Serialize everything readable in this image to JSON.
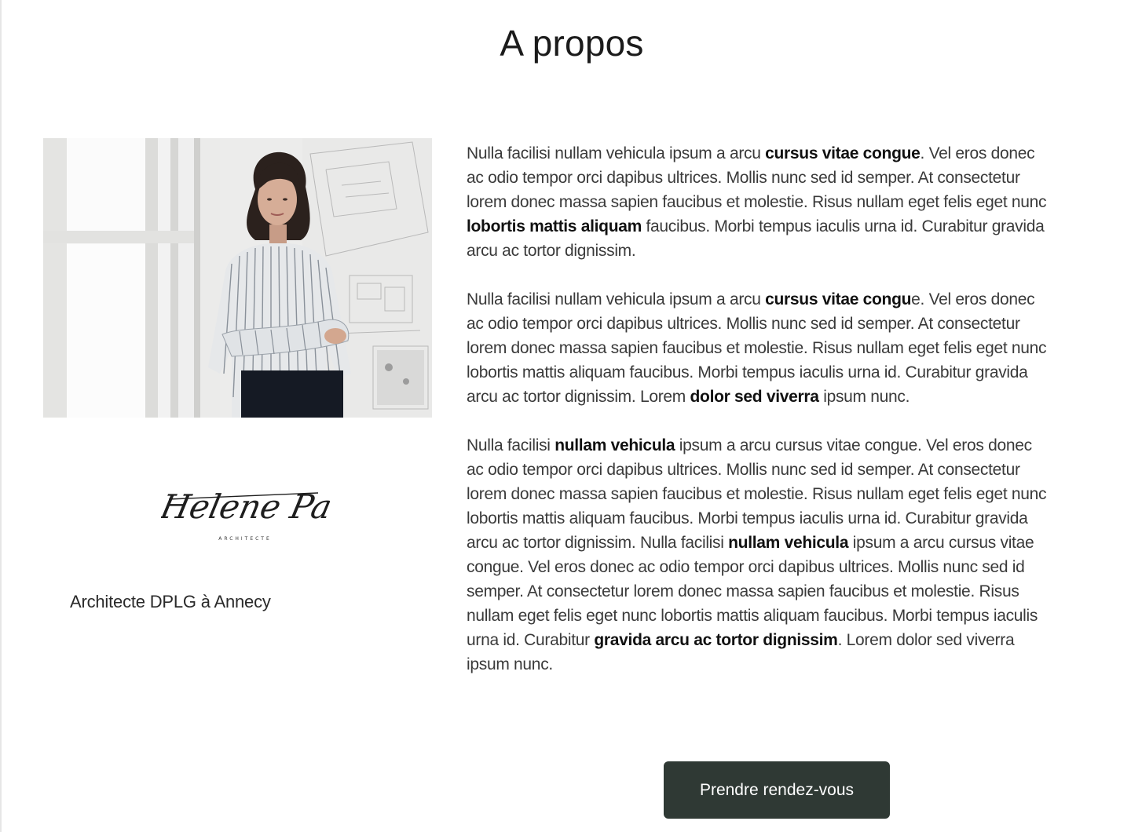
{
  "header": {
    "title": "A propos"
  },
  "profile": {
    "signature_name": "Helene Paquet",
    "signature_tagline": "ARCHITECTE",
    "subtitle": "Architecte DPLG  à Annecy"
  },
  "paragraphs": [
    [
      {
        "t": "Nulla facilisi nullam vehicula ipsum a arcu "
      },
      {
        "t": "cursus vitae congue",
        "b": true
      },
      {
        "t": ". Vel eros donec ac odio tempor orci dapibus ultrices. Mollis nunc sed id semper. At consectetur lorem donec massa sapien faucibus et molestie. Risus nullam eget felis eget nunc "
      },
      {
        "t": "lobortis mattis aliquam",
        "b": true
      },
      {
        "t": " faucibus. Morbi tempus iaculis urna id. Curabitur gravida arcu ac tortor dignissim."
      }
    ],
    [
      {
        "t": "Nulla facilisi nullam vehicula ipsum a arcu "
      },
      {
        "t": "cursus vitae congu",
        "b": true
      },
      {
        "t": "e. Vel eros donec ac odio tempor orci dapibus ultrices. Mollis nunc sed id semper. At consectetur lorem donec massa sapien faucibus et molestie. Risus nullam eget felis eget nunc lobortis mattis aliquam faucibus. Morbi tempus iaculis urna id. Curabitur gravida arcu ac tortor dignissim. Lorem "
      },
      {
        "t": "dolor sed viverra",
        "b": true
      },
      {
        "t": " ipsum nunc."
      }
    ],
    [
      {
        "t": "Nulla facilisi "
      },
      {
        "t": "nullam vehicula",
        "b": true
      },
      {
        "t": " ipsum a arcu cursus vitae congue. Vel eros donec ac odio tempor orci dapibus ultrices. Mollis nunc sed id semper. At consectetur lorem donec massa sapien faucibus et molestie. Risus nullam eget felis eget nunc lobortis mattis aliquam faucibus. Morbi tempus iaculis urna id. Curabitur gravida arcu ac tortor dignissim. Nulla facilisi "
      },
      {
        "t": "nullam vehicula",
        "b": true
      },
      {
        "t": " ipsum a arcu cursus vitae congue. Vel eros donec ac odio tempor orci dapibus ultrices. Mollis nunc sed id semper. At consectetur lorem donec massa sapien faucibus et molestie. Risus nullam eget felis eget nunc lobortis mattis aliquam faucibus. Morbi tempus iaculis urna id. Curabitur "
      },
      {
        "t": "gravida arcu ac tortor dignissim",
        "b": true
      },
      {
        "t": ". Lorem dolor sed viverra ipsum nunc."
      }
    ]
  ],
  "cta": {
    "label": "Prendre rendez-vous"
  },
  "colors": {
    "button_bg": "#2f3934",
    "button_text": "#ffffff",
    "text": "#3a3a3a",
    "strong_text": "#111111"
  }
}
